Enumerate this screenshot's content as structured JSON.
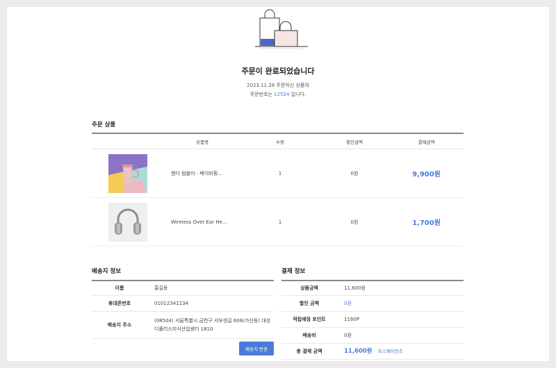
{
  "header": {
    "title": "주문이 완료되었습니다",
    "date": "2023.11.28",
    "line1_suffix": "주문하신 상품의",
    "order_prefix": "주문번호는",
    "order_number": "12524",
    "order_suffix": "입니다."
  },
  "products_section": {
    "title": "주문 상품",
    "columns": [
      "상품명",
      "수량",
      "할인금액",
      "결제금액"
    ],
    "items": [
      {
        "name": "핸디 텀블러 - 베이비핑…",
        "qty": "1",
        "discount": "0원",
        "price": "9,900원",
        "image": "tumbler-image"
      },
      {
        "name": "Wireless Over Ear He…",
        "qty": "1",
        "discount": "0원",
        "price": "1,700원",
        "image": "headphone-image"
      }
    ]
  },
  "shipping": {
    "title": "배송지 정보",
    "rows": [
      {
        "label": "이름",
        "value": "홍길동"
      },
      {
        "label": "휴대폰번호",
        "value": "01012341234"
      },
      {
        "label": "배송지 주소",
        "value": "(08504) 서울특별시 금천구 서부샛길 606(가산동) 대성디폴리스지식산업센터 1810"
      }
    ],
    "change_button": "배송지 변경"
  },
  "payment": {
    "title": "결제 정보",
    "rows": [
      {
        "label": "상품금액",
        "value": "11,600원"
      },
      {
        "label": "할인 금액",
        "value": "0원"
      },
      {
        "label": "적립예정 포인트",
        "value": "1160P"
      },
      {
        "label": "배송비",
        "value": "0원"
      },
      {
        "label": "총 결제 금액",
        "value": "11,600원"
      }
    ],
    "method": "토스페이먼츠"
  },
  "colors": {
    "accent": "#4a7bd8",
    "page_bg": "#ececec",
    "card_bg": "#ffffff"
  }
}
